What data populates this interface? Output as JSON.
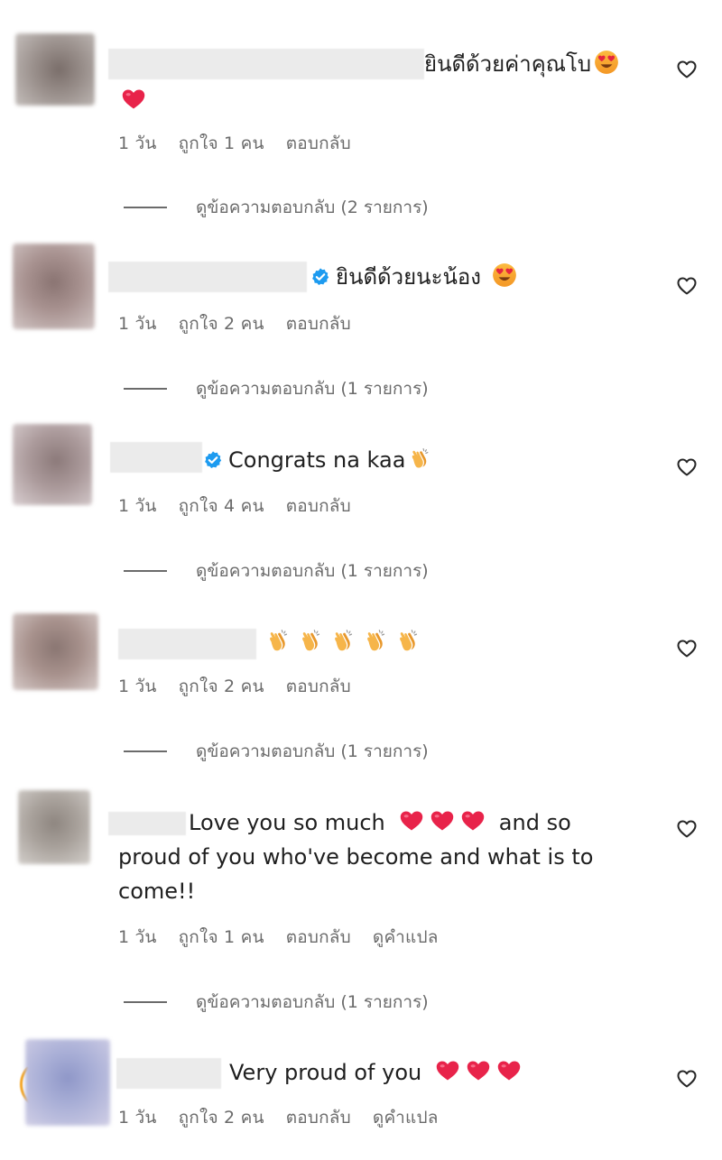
{
  "comments": [
    {
      "text_line1": "ยินดีด้วยค่าคุณโบ",
      "time": "1 วัน",
      "likes": "ถูกใจ 1 คน",
      "reply": "ตอบกลับ",
      "view_replies": "ดูข้อความตอบกลับ (2 รายการ)"
    },
    {
      "text_line1": "ยินดีด้วยนะน้อง",
      "time": "1 วัน",
      "likes": "ถูกใจ 2 คน",
      "reply": "ตอบกลับ",
      "view_replies": "ดูข้อความตอบกลับ (1 รายการ)"
    },
    {
      "text_line1": "Congrats na kaa",
      "time": "1 วัน",
      "likes": "ถูกใจ 4 คน",
      "reply": "ตอบกลับ",
      "view_replies": "ดูข้อความตอบกลับ (1 รายการ)"
    },
    {
      "time": "1 วัน",
      "likes": "ถูกใจ 2 คน",
      "reply": "ตอบกลับ",
      "view_replies": "ดูข้อความตอบกลับ (1 รายการ)"
    },
    {
      "text_line1a": "Love you so much",
      "text_line1b": "and so",
      "text_line2": "proud of you who've become and what is to",
      "text_line3": "come!!",
      "time": "1 วัน",
      "likes": "ถูกใจ 1 คน",
      "reply": "ตอบกลับ",
      "translate": "ดูคำแปล",
      "view_replies": "ดูข้อความตอบกลับ (1 รายการ)"
    },
    {
      "text_line1": "Very proud of you",
      "time": "1 วัน",
      "likes": "ถูกใจ 2 คน",
      "reply": "ตอบกลับ",
      "translate": "ดูคำแปล"
    }
  ],
  "icons": {
    "like": "heart-outline-icon",
    "verified": "verified-badge-icon",
    "heart_eyes": "heart-eyes-emoji-icon",
    "red_heart": "red-heart-emoji-icon",
    "clap": "clapping-hands-emoji-icon"
  },
  "colors": {
    "verified_blue": "#1d9bf0",
    "heart_red": "#e8234a",
    "meta_gray": "#6b6b6b"
  }
}
